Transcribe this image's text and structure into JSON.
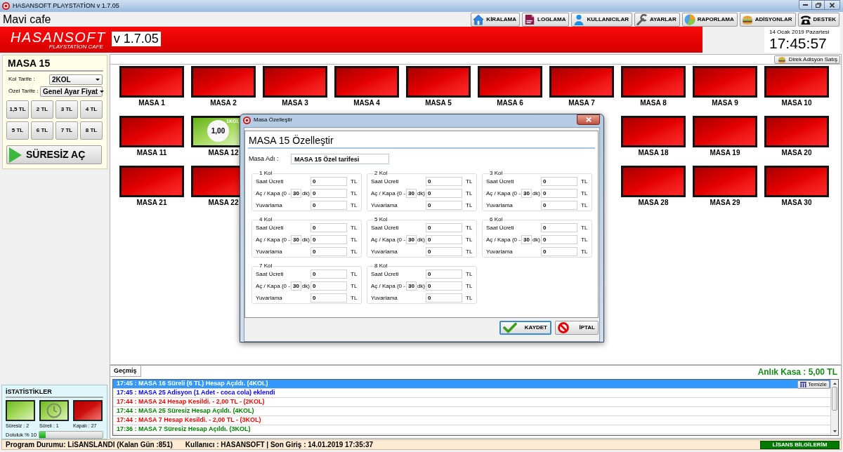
{
  "window": {
    "title": "HASANSOFT PLAYSTATİON v 1.7.05"
  },
  "header": {
    "cafe_name": "Mavi cafe"
  },
  "toolbar": [
    {
      "kind": "home",
      "label": "KİRALAMA"
    },
    {
      "kind": "log",
      "label": "LOGLAMA"
    },
    {
      "kind": "users",
      "label": "KULLANICILAR"
    },
    {
      "kind": "settings",
      "label": "AYARLAR"
    },
    {
      "kind": "reports",
      "label": "RAPORLAMA"
    },
    {
      "kind": "orders",
      "label": "ADİSYONLAR"
    },
    {
      "kind": "support",
      "label": "DESTEK"
    }
  ],
  "banner": {
    "logo": "HASANSOFT",
    "logo_subtitle": "PLAYSTATİON CAFE",
    "version": "v 1.7.05"
  },
  "clock": {
    "date": "14 Ocak 2019 Pazartesi",
    "time": "17:45:57"
  },
  "table_panel": {
    "title": "MASA 15",
    "kol_tarife_label": "Kol Tarife :",
    "kol_tarife": "2KOL",
    "ozel_tarife_label": "Özel Tarife :",
    "ozel_tarife": "Genel Ayar Fiyat",
    "prices": [
      "1,5 TL",
      "2 TL",
      "3 TL",
      "4 TL",
      "5 TL",
      "6 TL",
      "7 TL",
      "8 TL"
    ],
    "open_button": "SÜRESİZ AÇ"
  },
  "direct_sale_button": "Direk Adisyon Satış",
  "table_rows": [
    {
      "left": [
        {
          "name": "MASA 1",
          "open": false
        },
        {
          "name": "MASA 2",
          "open": false
        },
        {
          "name": "MASA 3",
          "open": false
        },
        {
          "name": "MASA 4",
          "open": false
        },
        {
          "name": "MASA 5",
          "open": false
        },
        {
          "name": "MASA 6",
          "open": false
        },
        {
          "name": "MASA 7",
          "open": false
        },
        {
          "name": "MASA 8",
          "open": false
        },
        {
          "name": "MASA 9",
          "open": false
        },
        {
          "name": "MASA 10",
          "open": false
        }
      ],
      "right": []
    },
    {
      "left": [
        {
          "name": "MASA 11",
          "open": false
        },
        {
          "name": "MASA 12",
          "open": true,
          "amount": "1,00",
          "tag": "1KOL"
        }
      ],
      "right": [
        {
          "name": "MASA 18",
          "open": false
        },
        {
          "name": "MASA 19",
          "open": false
        },
        {
          "name": "MASA 20",
          "open": false
        }
      ]
    },
    {
      "left": [
        {
          "name": "MASA 21",
          "open": false
        },
        {
          "name": "MASA 22",
          "open": false
        }
      ],
      "right": [
        {
          "name": "MASA 28",
          "open": false
        },
        {
          "name": "MASA 29",
          "open": false
        },
        {
          "name": "MASA 30",
          "open": false
        }
      ]
    }
  ],
  "dialog": {
    "title": "Masa Özelleştir",
    "heading": "MASA 15 Özelleştir",
    "name_label": "Masa Adı :",
    "name_value": "MASA 15 Özel tarifesi",
    "groups": [
      {
        "title": "1 Kol",
        "rows": [
          {
            "kind": "plain",
            "label": "Saat Ücreti",
            "value": "0",
            "unit": "TL"
          },
          {
            "kind": "minutes",
            "label": "Aç / Kapa (0 -",
            "minutes": "30",
            "minutes_unit": "dk)",
            "value": "0",
            "unit": "TL"
          },
          {
            "kind": "plain",
            "label": "Yuvarlama",
            "value": "0",
            "unit": "TL"
          }
        ]
      },
      {
        "title": "2 Kol",
        "rows": [
          {
            "kind": "plain",
            "label": "Saat Ücreti",
            "value": "0",
            "unit": "TL"
          },
          {
            "kind": "minutes",
            "label": "Aç / Kapa (0 -",
            "minutes": "30",
            "minutes_unit": "dk)",
            "value": "0",
            "unit": "TL"
          },
          {
            "kind": "plain",
            "label": "Yuvarlama",
            "value": "0",
            "unit": "TL"
          }
        ]
      },
      {
        "title": "3 Kol",
        "rows": [
          {
            "kind": "plain",
            "label": "Saat Ücreti",
            "value": "0",
            "unit": "TL"
          },
          {
            "kind": "minutes",
            "label": "Aç / Kapa (0 -",
            "minutes": "30",
            "minutes_unit": "dk)",
            "value": "0",
            "unit": "TL"
          },
          {
            "kind": "plain",
            "label": "Yuvarlama",
            "value": "0",
            "unit": "TL"
          }
        ]
      },
      {
        "title": "4 Kol",
        "rows": [
          {
            "kind": "plain",
            "label": "Saat Ücreti",
            "value": "0",
            "unit": "TL"
          },
          {
            "kind": "minutes",
            "label": "Aç / Kapa (0 -",
            "minutes": "30",
            "minutes_unit": "dk)",
            "value": "0",
            "unit": "TL"
          },
          {
            "kind": "plain",
            "label": "Yuvarlama",
            "value": "0",
            "unit": "TL"
          }
        ]
      },
      {
        "title": "5 Kol",
        "rows": [
          {
            "kind": "plain",
            "label": "Saat Ücreti",
            "value": "0",
            "unit": "TL"
          },
          {
            "kind": "minutes",
            "label": "Aç / Kapa (0 -",
            "minutes": "30",
            "minutes_unit": "dk)",
            "value": "0",
            "unit": "TL"
          },
          {
            "kind": "plain",
            "label": "Yuvarlama",
            "value": "0",
            "unit": "TL"
          }
        ]
      },
      {
        "title": "6 Kol",
        "rows": [
          {
            "kind": "plain",
            "label": "Saat Ücreti",
            "value": "0",
            "unit": "TL"
          },
          {
            "kind": "minutes",
            "label": "Aç / Kapa (0 -",
            "minutes": "30",
            "minutes_unit": "dk)",
            "value": "0",
            "unit": "TL"
          },
          {
            "kind": "plain",
            "label": "Yuvarlama",
            "value": "0",
            "unit": "TL"
          }
        ]
      },
      {
        "title": "7 Kol",
        "rows": [
          {
            "kind": "plain",
            "label": "Saat Ücreti",
            "value": "0",
            "unit": "TL"
          },
          {
            "kind": "minutes",
            "label": "Aç / Kapa (0 -",
            "minutes": "30",
            "minutes_unit": "dk)",
            "value": "0",
            "unit": "TL"
          },
          {
            "kind": "plain",
            "label": "Yuvarlama",
            "value": "0",
            "unit": "TL"
          }
        ]
      },
      {
        "title": "8 Kol",
        "rows": [
          {
            "kind": "plain",
            "label": "Saat Ücreti",
            "value": "0",
            "unit": "TL"
          },
          {
            "kind": "minutes",
            "label": "Aç / Kapa (0 -",
            "minutes": "30",
            "minutes_unit": "dk)",
            "value": "0",
            "unit": "TL"
          },
          {
            "kind": "plain",
            "label": "Yuvarlama",
            "value": "0",
            "unit": "TL"
          }
        ]
      }
    ],
    "save_button": {
      "label": "KAYDET",
      "focused": true
    },
    "cancel_button": {
      "label": "İPTAL",
      "focused": false
    }
  },
  "history": {
    "tab": "Geçmiş",
    "cash": "Anlık Kasa : 5,00 TL",
    "clear_button": "Temizle",
    "entries": [
      {
        "text": "17:45 : MASA 16 Süreli (6 TL) Hesap Açıldı. (4KOL)",
        "selected": true
      },
      {
        "text": "17:45 : MASA 25 Adisyon (1 Adet - coca cola) eklendi",
        "color": "#0000ff",
        "selected": false
      },
      {
        "text": "17:44 : MASA 24 Hesap Kesildi. - 2,00 TL - (2KOL)",
        "color": "#ff0000",
        "selected": false
      },
      {
        "text": "17:44 : MASA 25 Süresiz Hesap Açıldı. (4KOL)",
        "color": "#008000",
        "selected": false
      },
      {
        "text": "17:44 : MASA 7 Hesap Kesildi. - 2,00 TL - (3KOL)",
        "color": "#ff0000",
        "selected": false
      },
      {
        "text": "17:36 : MASA 7 Süresiz Hesap Açıldı. (3KOL)",
        "color": "#008000",
        "selected": false
      }
    ]
  },
  "stats": {
    "title": "İSTATİSTİKLER",
    "items": [
      {
        "kind": "untimed",
        "label": "Süresiz : 2"
      },
      {
        "kind": "timed",
        "label": "Süreli : 1"
      },
      {
        "kind": "closed",
        "label": "Kapalı : 27"
      }
    ],
    "occupancy": {
      "label": "Doluluk % 10",
      "level": 0.1
    }
  },
  "status_bar": {
    "program_status": "Program Durumu: LiSANSLANDI (Kalan Gün :851)",
    "user_info": "Kullanıcı : HASANSOFT | Son Giriş : 14.01.2019 17:35:37",
    "license_button": "LİSANS BİLGİLERİM"
  }
}
